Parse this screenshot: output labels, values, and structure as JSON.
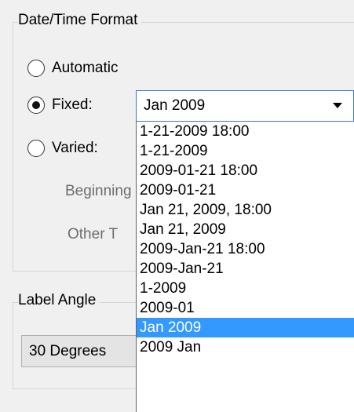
{
  "date_time_format": {
    "legend": "Date/Time Format",
    "options": [
      {
        "label": "Automatic",
        "checked": false
      },
      {
        "label": "Fixed:",
        "checked": true
      },
      {
        "label": "Varied:",
        "checked": false
      }
    ],
    "beginning_label": "Beginning",
    "other_label": "Other T",
    "fixed_combo": {
      "value": "Jan 2009",
      "icon": "chevron-down-icon"
    },
    "dropdown_options": [
      "1-21-2009 18:00",
      "1-21-2009",
      "2009-01-21 18:00",
      "2009-01-21",
      "Jan 21, 2009, 18:00",
      "Jan 21, 2009",
      "2009-Jan-21 18:00",
      "2009-Jan-21",
      "1-2009",
      "2009-01",
      "Jan 2009",
      "2009 Jan"
    ],
    "selected_option": "Jan 2009"
  },
  "label_angle": {
    "legend": "Label Angle",
    "value": "30 Degrees"
  },
  "colors": {
    "selection": "#3399ff",
    "focus_border": "#3a78c8",
    "background": "#f0f0f0"
  }
}
